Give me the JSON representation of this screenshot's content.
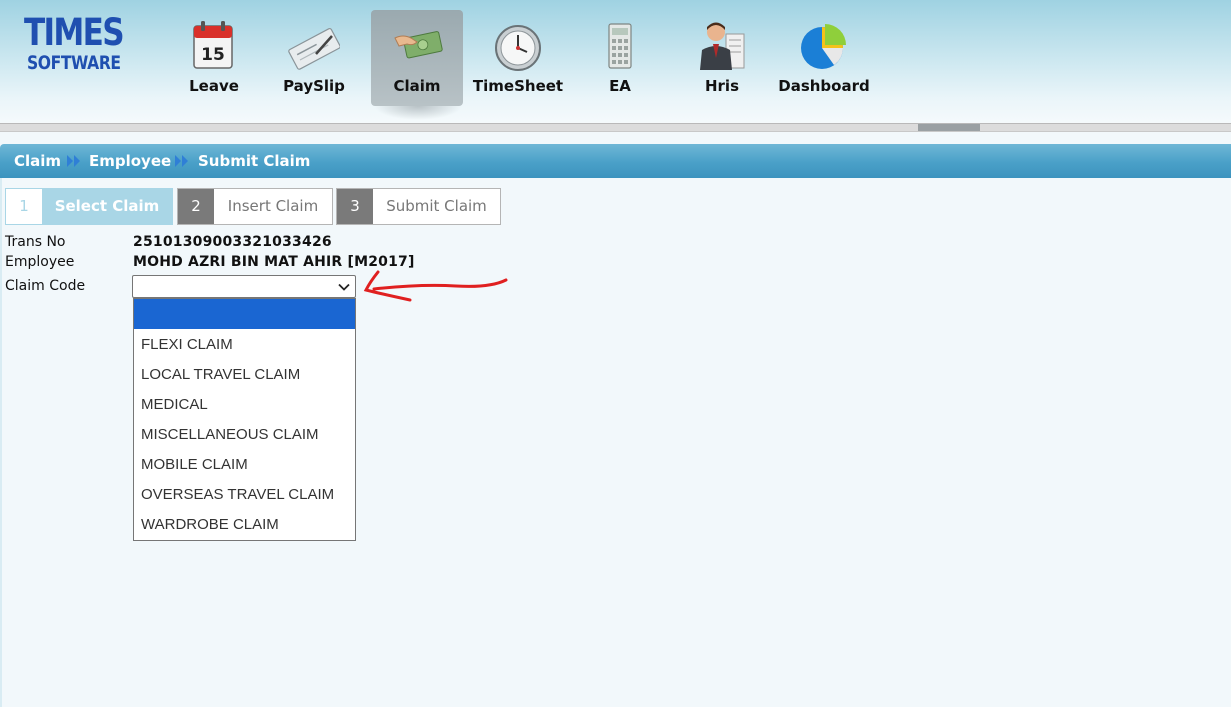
{
  "logo": {
    "line1": "TIMES",
    "line2": "SOFTWARE"
  },
  "nav": {
    "items": [
      {
        "label": "Leave",
        "icon": "calendar-icon",
        "active": false
      },
      {
        "label": "PaySlip",
        "icon": "cheque-icon",
        "active": false
      },
      {
        "label": "Claim",
        "icon": "money-hand-icon",
        "active": true
      },
      {
        "label": "TimeSheet",
        "icon": "clock-icon",
        "active": false
      },
      {
        "label": "EA",
        "icon": "calculator-icon",
        "active": false
      },
      {
        "label": "Hris",
        "icon": "person-icon",
        "active": false
      },
      {
        "label": "Dashboard",
        "icon": "pie-chart-icon",
        "active": false
      }
    ]
  },
  "breadcrumb": [
    "Claim",
    "Employee",
    "Submit Claim"
  ],
  "steps": [
    {
      "number": "1",
      "label": "Select Claim",
      "state": "current"
    },
    {
      "number": "2",
      "label": "Insert Claim",
      "state": "pending"
    },
    {
      "number": "3",
      "label": "Submit Claim",
      "state": "pending"
    }
  ],
  "form": {
    "trans_no_label": "Trans No",
    "trans_no_value": "25101309003321033426",
    "employee_label": "Employee",
    "employee_value": "MOHD AZRI BIN MAT AHIR [M2017]",
    "claim_code_label": "Claim Code",
    "claim_code_value": ""
  },
  "claim_options": [
    "",
    "FLEXI CLAIM",
    "LOCAL TRAVEL CLAIM",
    "MEDICAL",
    "MISCELLANEOUS CLAIM",
    "MOBILE CLAIM",
    "OVERSEAS TRAVEL CLAIM",
    "WARDROBE CLAIM"
  ],
  "colors": {
    "brand_blue": "#1f4fb0",
    "crumb_bar": "#4aa0c8",
    "step_current": "#a9d6e6",
    "option_highlight": "#1a66d2",
    "annotation_red": "#e02020"
  }
}
